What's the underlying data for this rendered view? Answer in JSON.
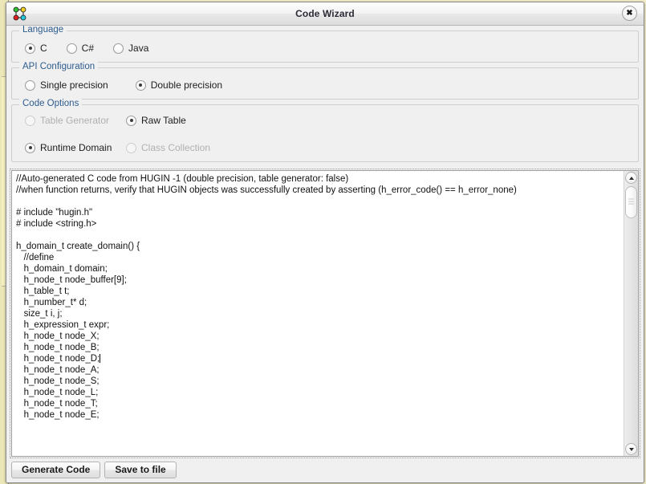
{
  "window": {
    "title": "Code Wizard",
    "icon": "network-graph-icon",
    "close_label": "✖"
  },
  "groups": {
    "language": {
      "title": "Language",
      "options": [
        {
          "label": "C",
          "checked": true,
          "disabled": false
        },
        {
          "label": "C#",
          "checked": false,
          "disabled": false
        },
        {
          "label": "Java",
          "checked": false,
          "disabled": false
        }
      ]
    },
    "api_configuration": {
      "title": "API Configuration",
      "options": [
        {
          "label": "Single precision",
          "checked": false,
          "disabled": false
        },
        {
          "label": "Double precision",
          "checked": true,
          "disabled": false
        }
      ]
    },
    "code_options": {
      "title": "Code Options",
      "options": [
        {
          "label": "Table Generator",
          "checked": false,
          "disabled": true
        },
        {
          "label": "Raw Table",
          "checked": true,
          "disabled": false
        },
        {
          "label": "Runtime Domain",
          "checked": true,
          "disabled": false
        },
        {
          "label": "Class Collection",
          "checked": false,
          "disabled": true
        }
      ]
    }
  },
  "code_editor": {
    "text_before_caret": "//Auto-generated C code from HUGIN -1 (double precision, table generator: false)\n//when function returns, verify that HUGIN objects was successfully created by asserting (h_error_code() == h_error_none)\n\n# include \"hugin.h\"\n# include <string.h>\n\nh_domain_t create_domain() {\n   //define\n   h_domain_t domain;\n   h_node_t node_buffer[9];\n   h_table_t t;\n   h_number_t* d;\n   size_t i, j;\n   h_expression_t expr;\n   h_node_t node_X;\n   h_node_t node_B;\n   h_node_t node_D;",
    "text_after_caret": "\n   h_node_t node_A;\n   h_node_t node_S;\n   h_node_t node_L;\n   h_node_t node_T;\n   h_node_t node_E;",
    "scrollbar": {
      "up_arrow": "chevron-up-icon",
      "down_arrow": "chevron-down-icon"
    }
  },
  "buttons": {
    "generate_code": "Generate Code",
    "save_to_file": "Save to file"
  },
  "colors": {
    "group_title": "#2d5c8e",
    "dialog_bg": "#f0f0f0",
    "editor_bg": "#ffffff",
    "backdrop": "#f2eec8"
  }
}
